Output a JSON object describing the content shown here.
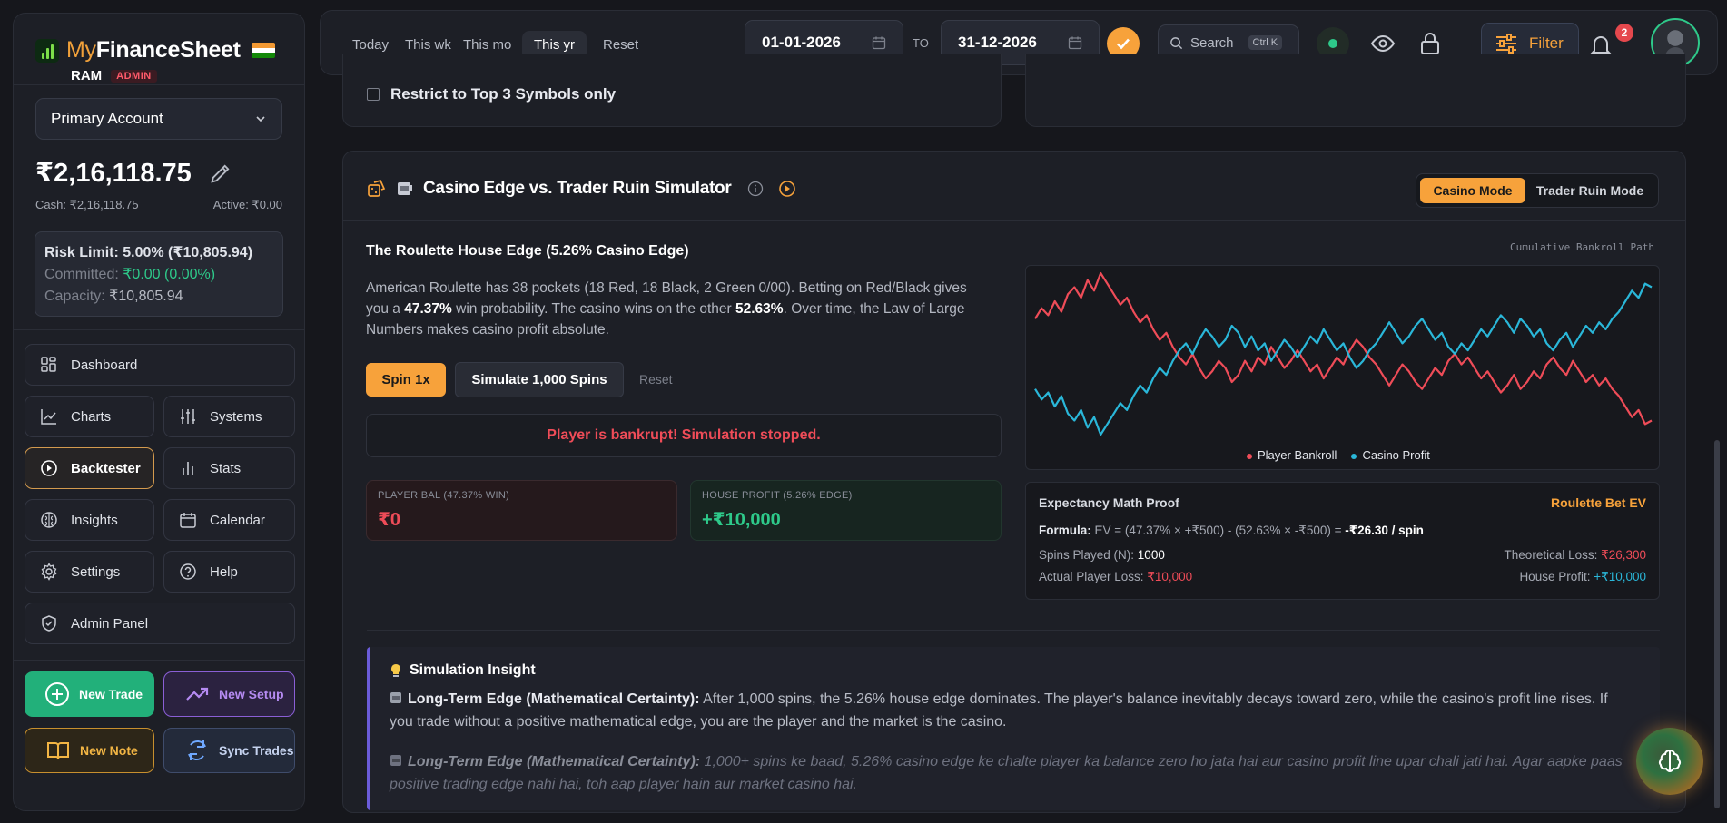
{
  "app": {
    "brand_part1": "My",
    "brand_part2": "FinanceSheet",
    "user_name": "RAM",
    "user_role": "ADMIN"
  },
  "account": {
    "selected": "Primary Account",
    "balance": "₹2,16,118.75",
    "cash": "Cash: ₹2,16,118.75",
    "active": "Active: ₹0.00",
    "risk_limit": "Risk Limit: 5.00% (₹10,805.94)",
    "committed_label": "Committed: ",
    "committed_value": "₹0.00 (0.00%)",
    "capacity_label": "Capacity: ",
    "capacity_value": "₹10,805.94"
  },
  "nav": {
    "dashboard": "Dashboard",
    "charts": "Charts",
    "systems": "Systems",
    "backtester": "Backtester",
    "stats": "Stats",
    "insights": "Insights",
    "calendar": "Calendar",
    "settings": "Settings",
    "help": "Help",
    "admin_panel": "Admin Panel"
  },
  "actions": {
    "new_trade": "New Trade",
    "new_setup": "New Setup",
    "new_note": "New Note",
    "sync_trades": "Sync Trades"
  },
  "topbar": {
    "ranges": [
      "Today",
      "This wk",
      "This mo",
      "This yr",
      "Reset"
    ],
    "active_range": "This yr",
    "date_from": "01-01-2026",
    "to_label": "TO",
    "date_to": "31-12-2026",
    "search_placeholder": "Search",
    "search_shortcut": "Ctrl K",
    "filter_label": "Filter",
    "notification_count": "2"
  },
  "top_card": {
    "checkbox_label": "Restrict to Top 3 Symbols only"
  },
  "simulator": {
    "title": "Casino Edge vs. Trader Ruin Simulator",
    "mode_casino": "Casino Mode",
    "mode_trader": "Trader Ruin Mode",
    "subtitle": "The Roulette House Edge (5.26% Casino Edge)",
    "desc_1": "American Roulette has 38 pockets (18 Red, 18 Black, 2 Green 0/00). Betting on Red/Black gives you a ",
    "desc_win": "47.37%",
    "desc_2": " win probability. The casino wins on the other ",
    "desc_lose": "52.63%",
    "desc_3": ". Over time, the Law of Large Numbers makes casino profit absolute.",
    "spin_button": "Spin 1x",
    "simulate_button": "Simulate 1,000 Spins",
    "reset_link": "Reset",
    "status_message": "Player is bankrupt! Simulation stopped.",
    "player_label": "PLAYER BAL (47.37% WIN)",
    "player_value": "₹0",
    "house_label": "HOUSE PROFIT (5.26% EDGE)",
    "house_value": "+₹10,000"
  },
  "chart_data": {
    "type": "line",
    "title": "Cumulative Bankroll Path",
    "grid": false,
    "legend": "bottom-center",
    "series": [
      {
        "name": "Player Bankroll",
        "color": "#ef4c58",
        "values": [
          10,
          13,
          11,
          15,
          12,
          17,
          19,
          16,
          21,
          18,
          23,
          20,
          17,
          14,
          16,
          12,
          9,
          11,
          7,
          4,
          6,
          2,
          -1,
          -3,
          0,
          -4,
          -7,
          -5,
          -2,
          -4,
          -8,
          -6,
          -2,
          -5,
          -1,
          -3,
          2,
          -1,
          -4,
          -2,
          1,
          -2,
          -5,
          -3,
          -7,
          -4,
          -1,
          -3,
          1,
          4,
          2,
          -1,
          -3,
          -6,
          -9,
          -6,
          -3,
          -5,
          -8,
          -10,
          -7,
          -4,
          -6,
          -2,
          0,
          -3,
          -1,
          -4,
          -7,
          -5,
          -8,
          -11,
          -9,
          -6,
          -10,
          -8,
          -5,
          -7,
          -3,
          -1,
          -4,
          -6,
          -2,
          -5,
          -8,
          -6,
          -9,
          -7,
          -10,
          -12,
          -15,
          -18,
          -16,
          -20,
          -19
        ]
      },
      {
        "name": "Casino Profit",
        "color": "#2ab7d9",
        "values": [
          -10,
          -13,
          -11,
          -15,
          -12,
          -17,
          -19,
          -16,
          -21,
          -18,
          -23,
          -20,
          -17,
          -14,
          -16,
          -12,
          -9,
          -11,
          -7,
          -4,
          -6,
          -2,
          1,
          3,
          0,
          4,
          7,
          5,
          2,
          4,
          8,
          6,
          2,
          5,
          1,
          3,
          -2,
          1,
          4,
          2,
          -1,
          2,
          5,
          3,
          7,
          4,
          1,
          3,
          -1,
          -4,
          -2,
          1,
          3,
          6,
          9,
          6,
          3,
          5,
          8,
          10,
          7,
          4,
          6,
          2,
          0,
          3,
          1,
          4,
          7,
          5,
          8,
          11,
          9,
          6,
          10,
          8,
          5,
          7,
          3,
          1,
          4,
          6,
          2,
          5,
          8,
          6,
          9,
          7,
          10,
          12,
          15,
          18,
          16,
          20,
          19
        ]
      }
    ]
  },
  "proof": {
    "title": "Expectancy Math Proof",
    "ev_label": "Roulette Bet EV",
    "formula_key": "Formula:",
    "formula_text": " EV = (47.37% × +₹500) - (52.63% × -₹500) = ",
    "formula_result": "-₹26.30 / spin",
    "spins_label": "Spins Played (N): ",
    "spins_value": "1000",
    "theoretical_label": "Theoretical Loss: ",
    "theoretical_value": "₹26,300",
    "actual_label": "Actual Player Loss: ",
    "actual_value": "₹10,000",
    "house_label": "House Profit: ",
    "house_value": "+₹10,000"
  },
  "insight": {
    "title": "Simulation Insight",
    "p1_bold": "Long-Term Edge (Mathematical Certainty):",
    "p1_text": " After 1,000 spins, the 5.26% house edge dominates. The player's balance inevitably decays toward zero, while the casino's profit line rises. If you trade without a positive mathematical edge, you are the player and the market is the casino.",
    "p2_bold": "Long-Term Edge (Mathematical Certainty):",
    "p2_text": " 1,000+ spins ke baad, 5.26% casino edge ke chalte player ka balance zero ho jata hai aur casino profit line upar chali jati hai. Agar aapke paas positive trading edge nahi hai, toh aap player hain aur market casino hai."
  }
}
